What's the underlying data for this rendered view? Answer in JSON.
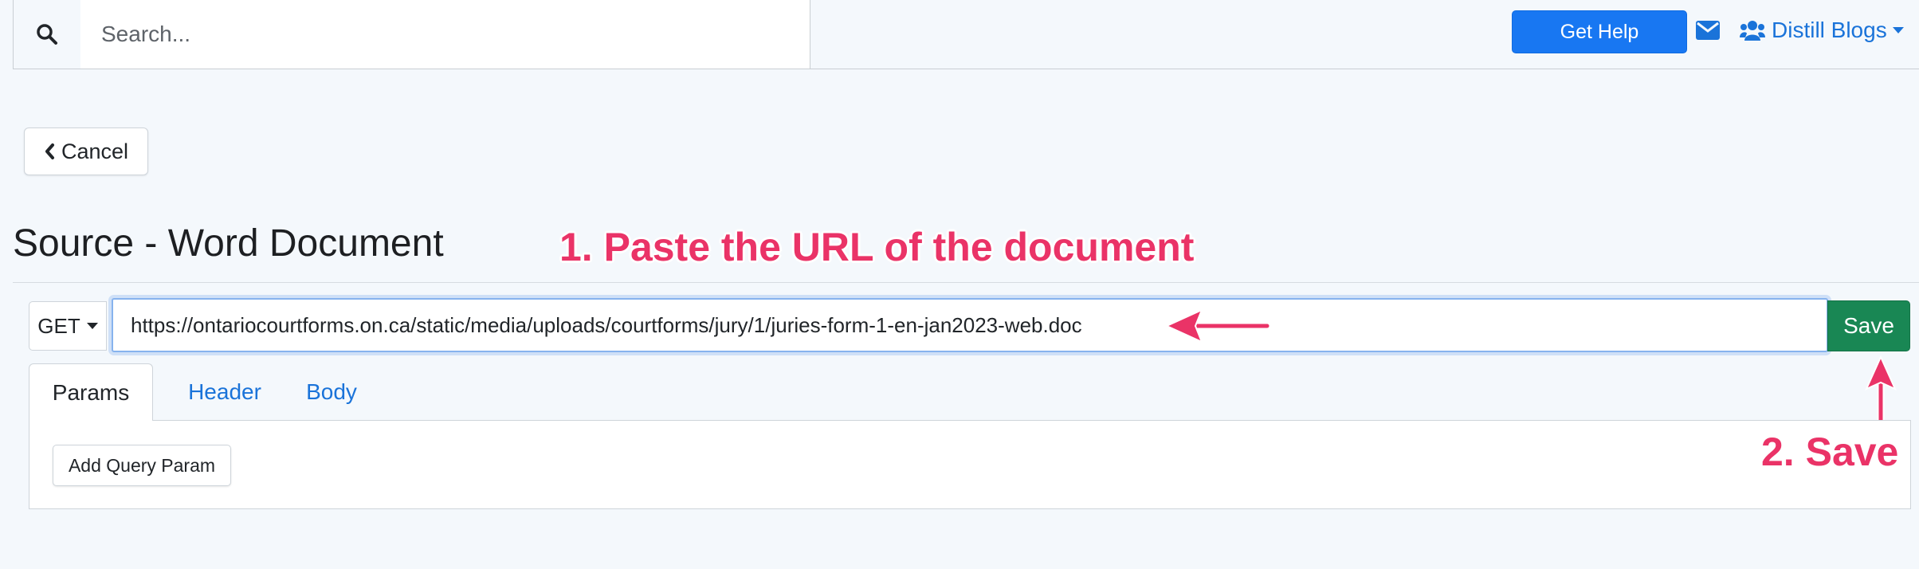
{
  "topbar": {
    "search_placeholder": "Search...",
    "search_value": "",
    "get_help_label": "Get Help",
    "blogs_label": "Distill Blogs"
  },
  "page": {
    "cancel_label": "Cancel",
    "title": "Source - Word Document"
  },
  "request": {
    "method": "GET",
    "url": "https://ontariocourtforms.on.ca/static/media/uploads/courtforms/jury/1/juries-form-1-en-jan2023-web.doc",
    "save_label": "Save"
  },
  "tabs": [
    {
      "label": "Params",
      "active": true
    },
    {
      "label": "Header",
      "active": false
    },
    {
      "label": "Body",
      "active": false
    }
  ],
  "params_panel": {
    "add_query_param_label": "Add Query Param"
  },
  "annotations": {
    "step1": "1. Paste the URL of the document",
    "step2": "2. Save"
  },
  "colors": {
    "primary": "#1877f2",
    "success": "#198754",
    "annotation": "#ea3367",
    "link": "#1a73d9",
    "background": "#f4f8fc"
  },
  "icons": [
    "search-icon",
    "envelope-icon",
    "users-icon",
    "chevron-left-icon",
    "caret-down-icon"
  ]
}
